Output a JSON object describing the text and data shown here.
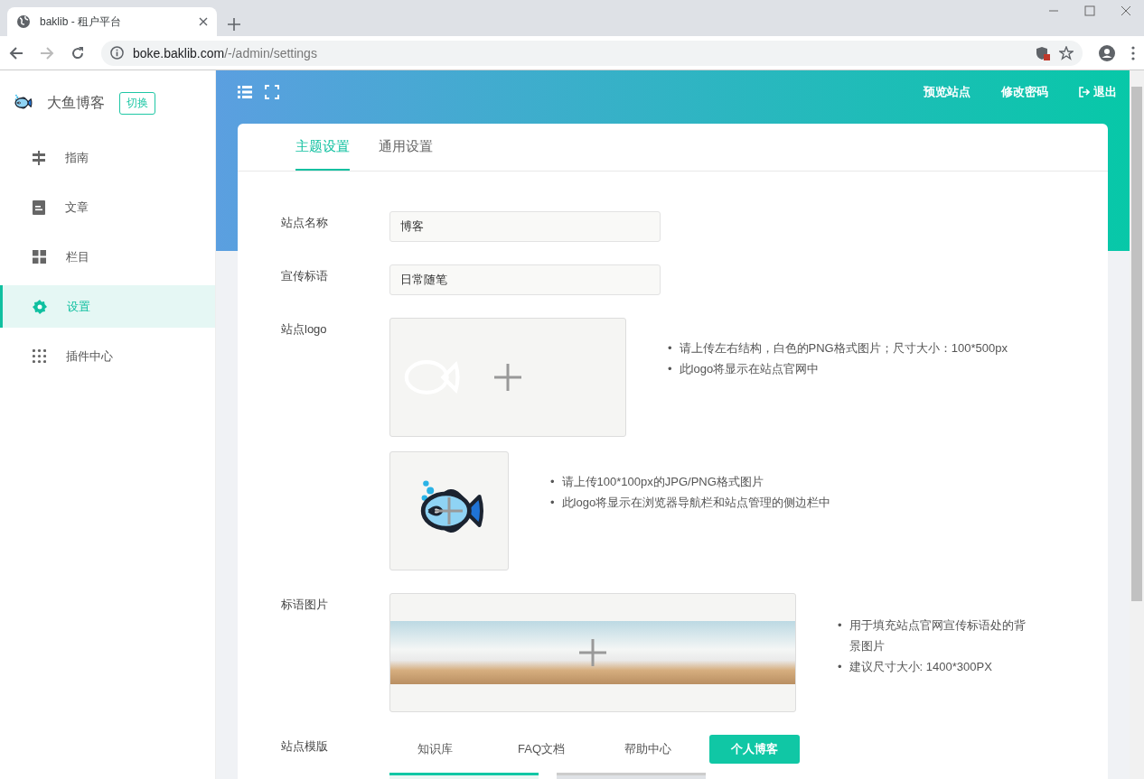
{
  "browser": {
    "tab_title": "baklib - 租户平台",
    "url_host": "boke.baklib.com",
    "url_path": "/-/admin/settings"
  },
  "sidebar": {
    "site_name": "大鱼博客",
    "switch_button": "切换",
    "items": [
      {
        "label": "指南",
        "selected": false
      },
      {
        "label": "文章",
        "selected": false
      },
      {
        "label": "栏目",
        "selected": false
      },
      {
        "label": "设置",
        "selected": true
      },
      {
        "label": "插件中心",
        "selected": false
      }
    ]
  },
  "header": {
    "links": [
      {
        "label": "预览站点",
        "kind": "plain"
      },
      {
        "label": "修改密码",
        "kind": "plain"
      },
      {
        "label": "退出",
        "kind": "logout"
      }
    ]
  },
  "tabs": [
    {
      "label": "主题设置",
      "selected": true
    },
    {
      "label": "通用设置",
      "selected": false
    }
  ],
  "form": {
    "site_name": {
      "label": "站点名称",
      "value": "博客"
    },
    "slogan": {
      "label": "宣传标语",
      "value": "日常随笔"
    },
    "logo": {
      "label": "站点logo",
      "wide_hints": [
        {
          "bullet": "•",
          "text": "请上传左右结构，白色的PNG格式图片；尺寸大小：100*500px"
        },
        {
          "bullet": "•",
          "text": "此logo将显示在站点官网中"
        }
      ],
      "square_hints": [
        {
          "bullet": "•",
          "text": "请上传100*100px的JPG/PNG格式图片"
        },
        {
          "bullet": "•",
          "text": "此logo将显示在浏览器导航栏和站点管理的侧边栏中"
        }
      ]
    },
    "banner": {
      "label": "标语图片",
      "hints": [
        {
          "bullet": "•",
          "text": "用于填充站点官网宣传标语处的背景图片"
        },
        {
          "bullet": "•",
          "text": "建议尺寸大小: 1400*300PX"
        }
      ]
    },
    "template": {
      "label": "站点模版",
      "options": [
        {
          "label": "知识库",
          "selected": false
        },
        {
          "label": "FAQ文档",
          "selected": false
        },
        {
          "label": "帮助中心",
          "selected": false
        },
        {
          "label": "个人博客",
          "selected": true
        }
      ]
    }
  }
}
